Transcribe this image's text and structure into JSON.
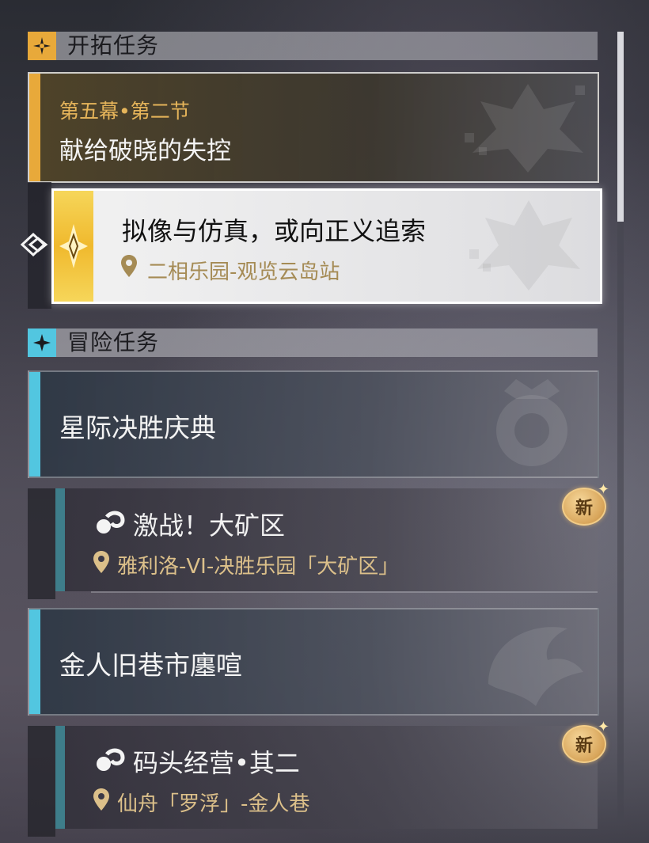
{
  "sections": {
    "trailblaze": {
      "title": "开拓任务"
    },
    "adventure": {
      "title": "冒险任务"
    }
  },
  "trailblaze_mission": {
    "chapter": "第五幕•第二节",
    "title": "献给破晓的失控",
    "current_step": {
      "title": "拟像与仿真，或向正义追索",
      "location": "二相乐园-观览云岛站"
    }
  },
  "adventure_missions": [
    {
      "title": "星际决胜庆典",
      "sub": {
        "title": "激战！大矿区",
        "location": "雅利洛-VI-决胜乐园「大矿区」",
        "badge": "新"
      }
    },
    {
      "title": "金人旧巷市廛喧",
      "sub": {
        "title": "码头经营•其二",
        "location": "仙舟「罗浮」-金人巷",
        "badge": "新"
      }
    }
  ],
  "icons": {
    "trailblaze": "trailblaze-star-icon",
    "adventure": "adventure-star-icon",
    "location": "location-pin-icon",
    "mission": "mission-type-icon",
    "selector": "selector-arrow-icon"
  },
  "colors": {
    "trailblaze_accent": "#e8a93a",
    "adventure_accent": "#52c6e0",
    "location_text_selected": "#a58b55",
    "location_text": "#dcc08a"
  }
}
